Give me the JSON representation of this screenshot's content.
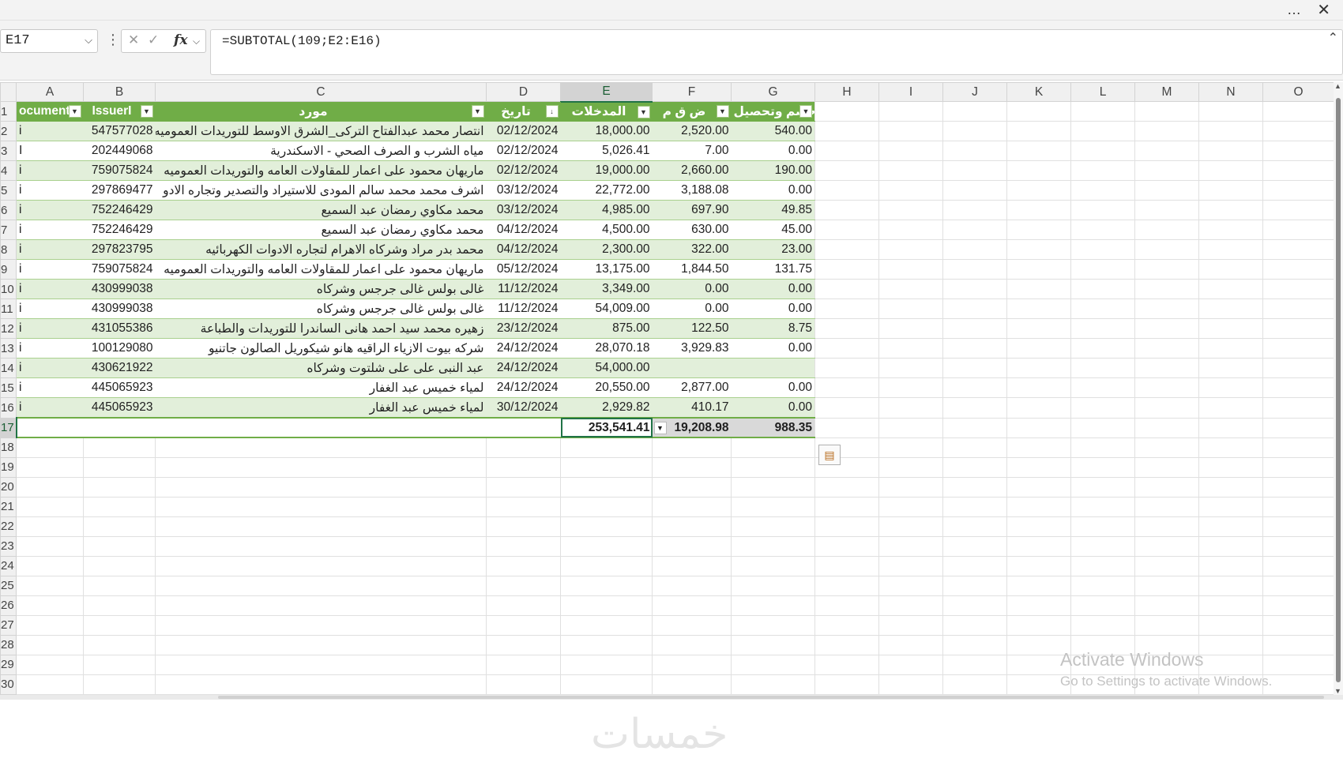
{
  "window": {
    "more_icon": "…",
    "close_icon": "✕"
  },
  "formula_bar": {
    "name_box": "E17",
    "cancel_icon": "✕",
    "enter_icon": "✓",
    "fx_label": "fx",
    "formula": "=SUBTOTAL(109;E2:E16)"
  },
  "columns": [
    "A",
    "B",
    "C",
    "D",
    "E",
    "F",
    "G",
    "H",
    "I",
    "J",
    "K",
    "L",
    "M",
    "N",
    "O"
  ],
  "table": {
    "headers": {
      "A": "ocument",
      "B": "IssuerI",
      "C": "مورد",
      "D": "تاريخ",
      "E": "المدخلات",
      "F": "ض ق م",
      "G": "خصم وتحصيل"
    },
    "rows": [
      {
        "row": "2",
        "A": "i",
        "B": "547577028",
        "C": "انتصار محمد عبدالفتاح الترکی_الشرق الاوسط للتوريدات العموميه",
        "D": "02/12/2024",
        "E": "18,000.00",
        "F": "2,520.00",
        "G": "540.00"
      },
      {
        "row": "3",
        "A": "I",
        "B": "202449068",
        "C": "مياه الشرب و الصرف الصحي - الاسكندرية",
        "D": "02/12/2024",
        "E": "5,026.41",
        "F": "7.00",
        "G": "0.00"
      },
      {
        "row": "4",
        "A": "i",
        "B": "759075824",
        "C": "ماريهان محمود على اعمار للمقاولات العامه والتوريدات العموميه",
        "D": "02/12/2024",
        "E": "19,000.00",
        "F": "2,660.00",
        "G": "190.00"
      },
      {
        "row": "5",
        "A": "i",
        "B": "297869477",
        "C": "اشرف محمد محمد سالم المودى للاستيراد والتصدير وتجاره الادو",
        "D": "03/12/2024",
        "E": "22,772.00",
        "F": "3,188.08",
        "G": "0.00"
      },
      {
        "row": "6",
        "A": "i",
        "B": "752246429",
        "C": "محمد مكاوي رمضان عبد السميع",
        "D": "03/12/2024",
        "E": "4,985.00",
        "F": "697.90",
        "G": "49.85"
      },
      {
        "row": "7",
        "A": "i",
        "B": "752246429",
        "C": "محمد مكاوي رمضان عبد السميع",
        "D": "04/12/2024",
        "E": "4,500.00",
        "F": "630.00",
        "G": "45.00"
      },
      {
        "row": "8",
        "A": "i",
        "B": "297823795",
        "C": "محمد بدر مراد وشركاه الاهرام لتجاره الادوات الكهربائيه",
        "D": "04/12/2024",
        "E": "2,300.00",
        "F": "322.00",
        "G": "23.00"
      },
      {
        "row": "9",
        "A": "i",
        "B": "759075824",
        "C": "ماريهان محمود على اعمار للمقاولات العامه والتوريدات العموميه",
        "D": "05/12/2024",
        "E": "13,175.00",
        "F": "1,844.50",
        "G": "131.75"
      },
      {
        "row": "10",
        "A": "i",
        "B": "430999038",
        "C": "غالى بولس غالى جرجس وشركاه",
        "D": "11/12/2024",
        "E": "3,349.00",
        "F": "0.00",
        "G": "0.00"
      },
      {
        "row": "11",
        "A": "i",
        "B": "430999038",
        "C": "غالى بولس غالى جرجس وشركاه",
        "D": "11/12/2024",
        "E": "54,009.00",
        "F": "0.00",
        "G": "0.00"
      },
      {
        "row": "12",
        "A": "i",
        "B": "431055386",
        "C": "زهيره محمد سيد احمد هانى الساندرا للتوريدات والطباعة",
        "D": "23/12/2024",
        "E": "875.00",
        "F": "122.50",
        "G": "8.75"
      },
      {
        "row": "13",
        "A": "i",
        "B": "100129080",
        "C": "شركه بيوت الازياء الراقيه هانو شيكوريل الصالون جاتنيو",
        "D": "24/12/2024",
        "E": "28,070.18",
        "F": "3,929.83",
        "G": "0.00"
      },
      {
        "row": "14",
        "A": "i",
        "B": "430621922",
        "C": "عبد النبى على على شلتوت وشركاه",
        "D": "24/12/2024",
        "E": "54,000.00",
        "F": "",
        "G": ""
      },
      {
        "row": "15",
        "A": "i",
        "B": "445065923",
        "C": "لمياء خميس عبد الغفار",
        "D": "24/12/2024",
        "E": "20,550.00",
        "F": "2,877.00",
        "G": "0.00"
      },
      {
        "row": "16",
        "A": "i",
        "B": "445065923",
        "C": "لمياء خميس عبد الغفار",
        "D": "30/12/2024",
        "E": "2,929.82",
        "F": "410.17",
        "G": "0.00"
      }
    ],
    "totals": {
      "row": "17",
      "E": "253,541.41",
      "F": "19,208.98",
      "G": "988.35"
    }
  },
  "empty_rows": [
    "18",
    "19",
    "20",
    "21",
    "22",
    "23",
    "24",
    "25",
    "26",
    "27",
    "28",
    "29",
    "30"
  ],
  "activation": {
    "title": "Activate Windows",
    "subtitle": "Go to Settings to activate Windows."
  },
  "watermark": "خمسات",
  "colors": {
    "table_header": "#70ad47",
    "band": "#e2efda",
    "selection": "#217346"
  }
}
